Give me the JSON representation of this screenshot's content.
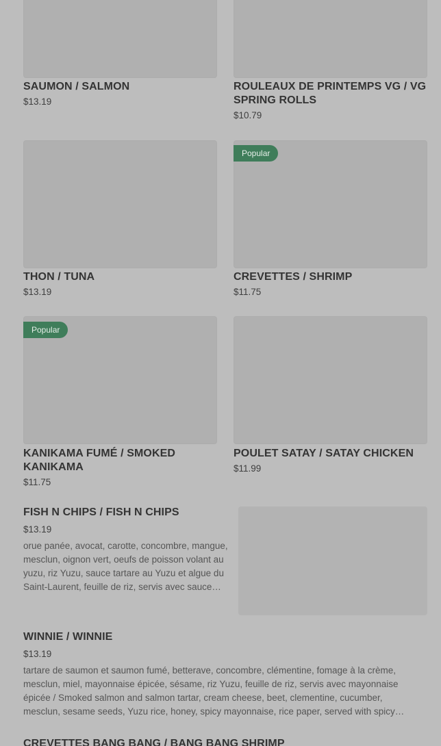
{
  "menu": {
    "grid": [
      {
        "title": "SAUMON / SALMON",
        "price": "$13.19",
        "popular": ""
      },
      {
        "title": "ROULEAUX DE PRINTEMPS VG / VG SPRING ROLLS",
        "price": "$10.79",
        "popular": ""
      },
      {
        "title": "THON / TUNA",
        "price": "$13.19",
        "popular": ""
      },
      {
        "title": "CREVETTES / SHRIMP",
        "price": "$11.75",
        "popular": "Popular"
      },
      {
        "title": "KANIKAMA FUMÉ / SMOKED KANIKAMA",
        "price": "$11.75",
        "popular": "Popular"
      },
      {
        "title": "POULET SATAY / SATAY CHICKEN",
        "price": "$11.99",
        "popular": ""
      }
    ],
    "list": [
      {
        "title": "FISH N CHIPS / FISH N CHIPS",
        "price": "$13.19",
        "description": "orue panée, avocat, carotte, concombre, mangue, mesclun, oignon vert, oeufs de poisson volant au yuzu, riz Yuzu, sauce tartare au Yuzu et algue du Saint-Laurent, feuille de riz, servis avec sauce tartare"
      },
      {
        "title": "WINNIE / WINNIE",
        "price": "$13.19",
        "description": "tartare de saumon et saumon fumé, betterave, concombre, clémentine, fomage à la crème, mesclun, miel, mayonnaise épicée, sésame, riz Yuzu, feuille de riz, servis avec mayonnaise épicée / Smoked salmon and salmon tartar, cream cheese, beet, clementine, cucumber, mesclun, sesame seeds, Yuzu rice, honey, spicy mayonnaise, rice paper, served with spicy mayonnaise"
      },
      {
        "title": "CREVETTES BANG BANG / BANG BANG SHRIMP",
        "price": "",
        "description": ""
      }
    ]
  }
}
